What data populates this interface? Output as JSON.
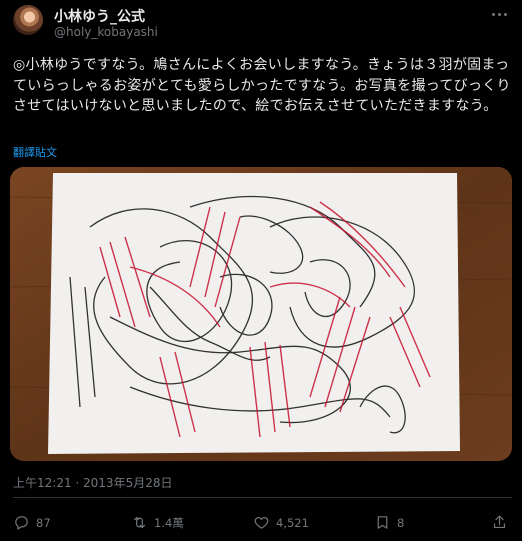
{
  "author": {
    "name": "小林ゆう_公式",
    "handle": "@holy_kobayashi"
  },
  "post": {
    "text": "◎小林ゆうですなう。鳩さんによくお会いしますなう。きょうは３羽が固まっていらっしゃるお姿がとても愛らしかったですなう。お写真を撮ってびっくりさせてはいけないと思いましたので、絵でお伝えさせていただきますなう。",
    "translate_label": "翻譯貼文",
    "timestamp": "上午12:21 · 2013年5月28日"
  },
  "actions": {
    "replies": "87",
    "reposts": "1.4萬",
    "likes": "4,521",
    "bookmarks": "8"
  },
  "icons": {
    "more": "more-icon",
    "reply": "reply-icon",
    "repost": "repost-icon",
    "like": "heart-icon",
    "bookmark": "bookmark-icon",
    "share": "share-icon"
  },
  "colors": {
    "background": "#000000",
    "text": "#e7e9ea",
    "muted": "#71767b",
    "link": "#1d9bf0",
    "divider": "#2f3336"
  }
}
